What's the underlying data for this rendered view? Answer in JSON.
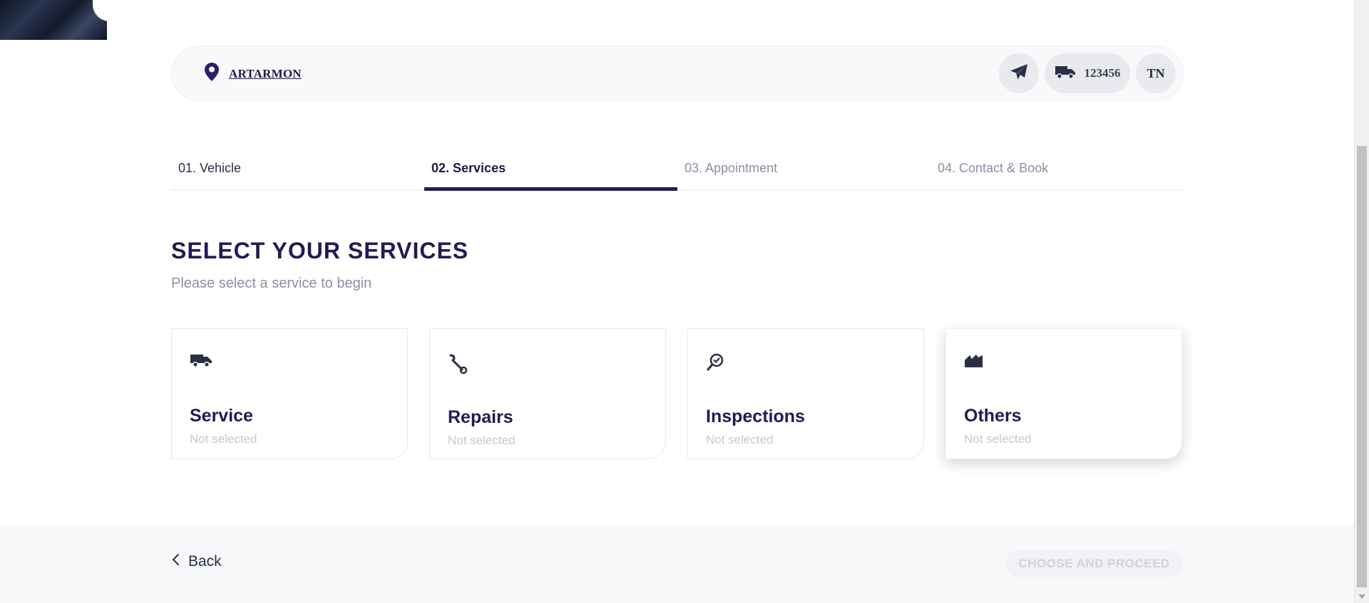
{
  "header": {
    "location": "ARTARMON",
    "vehicle_number": "123456",
    "user_initials": "TN"
  },
  "steps": [
    {
      "label": "01. Vehicle",
      "state": "done"
    },
    {
      "label": "02. Services",
      "state": "active"
    },
    {
      "label": "03. Appointment",
      "state": "pending"
    },
    {
      "label": "04. Contact & Book",
      "state": "pending"
    }
  ],
  "main": {
    "title": "SELECT YOUR SERVICES",
    "subtitle": "Please select a service to begin"
  },
  "services": [
    {
      "name": "Service",
      "status": "Not selected",
      "icon": "truck-icon"
    },
    {
      "name": "Repairs",
      "status": "Not selected",
      "icon": "wrench-icon"
    },
    {
      "name": "Inspections",
      "status": "Not selected",
      "icon": "inspection-icon"
    },
    {
      "name": "Others",
      "status": "Not selected",
      "icon": "others-icon"
    }
  ],
  "footer": {
    "back_label": "Back",
    "proceed_label": "CHOOSE AND PROCEED"
  },
  "colors": {
    "primary": "#211b5e",
    "muted_text": "#8a8fa3",
    "disabled_text": "#d2d4db",
    "header_bg": "#f8f9fb"
  }
}
